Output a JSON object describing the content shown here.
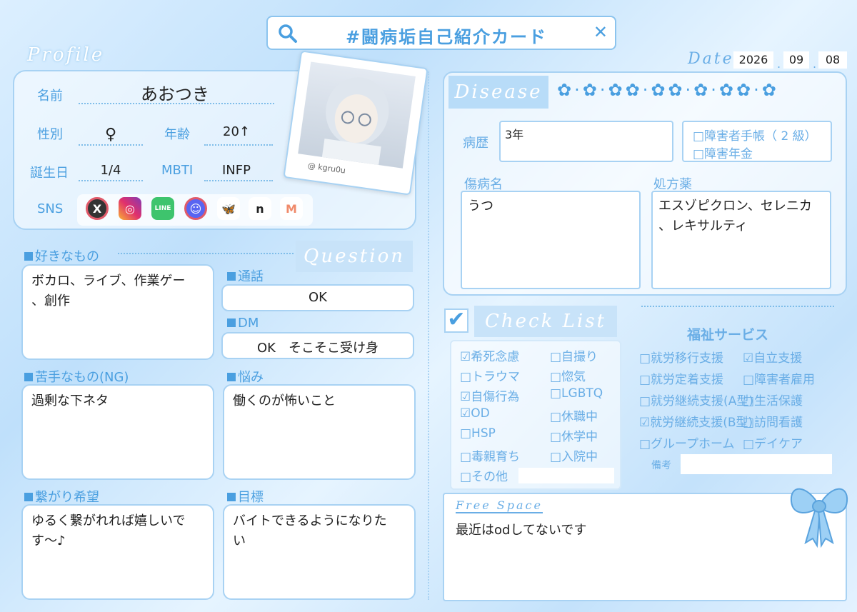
{
  "title": "#闘病垢自己紹介カード",
  "date": {
    "label": "Date",
    "year": "2026",
    "month": "09",
    "day": "08"
  },
  "profile": {
    "heading": "Profile",
    "name_label": "名前",
    "name": "あおつき",
    "gender_label": "性別",
    "gender": "♀",
    "age_label": "年齢",
    "age": "20↑",
    "birthday_label": "誕生日",
    "birthday": "1/4",
    "mbti_label": "MBTI",
    "mbti": "INFP",
    "sns_label": "SNS",
    "sns_icons": [
      "x-icon",
      "instagram-icon",
      "line-icon",
      "discord-icon",
      "bluesky-icon",
      "note-icon",
      "misskey-icon"
    ],
    "photo_handle": "@ kgru0u"
  },
  "likes": {
    "title": "好きなもの",
    "text": "ボカロ、ライブ、作業ゲー\n、創作"
  },
  "question": {
    "heading": "Question",
    "call_title": "通話",
    "call": "OK",
    "dm_title": "DM",
    "dm": "OK　そこそこ受け身"
  },
  "dislikes": {
    "title": "苦手なもの(NG)",
    "text": "過剰な下ネタ"
  },
  "worries": {
    "title": "悩み",
    "text": "働くのが怖いこと"
  },
  "connect": {
    "title": "繋がり希望",
    "text": "ゆるく繋がれれば嬉しいで\nす〜♪"
  },
  "goal": {
    "title": "目標",
    "text": "バイトできるようになりた\nい"
  },
  "disease": {
    "heading": "Disease",
    "history_label": "病歴",
    "history": "3年",
    "notebook": "□障害者手帳（ 2 級）",
    "pension": "□障害年金",
    "name_label": "傷病名",
    "name": "うつ",
    "meds_label": "処方薬",
    "meds": "エスゾピクロン、セレニカ\n、レキサルティ"
  },
  "checklist": {
    "heading": "Check List",
    "col1": [
      "☑希死念慮",
      "□トラウマ",
      "☑自傷行為",
      "☑OD",
      "□HSP",
      "□毒親育ち",
      "□その他"
    ],
    "col2": [
      "□自撮り",
      "□惚気",
      "□LGBTQ",
      "□休職中",
      "□休学中",
      "□入院中"
    ]
  },
  "welfare": {
    "title": "福祉サービス",
    "col1": [
      "□就労移行支援",
      "□就労定着支援",
      "□就労継続支援(A型)",
      "☑就労継続支援(B型)",
      "□グループホーム"
    ],
    "col2": [
      "☑自立支援",
      "□障害者雇用",
      "□生活保護",
      "□訪問看護",
      "□デイケア"
    ],
    "notes_label": "備考"
  },
  "free": {
    "heading": "Free Space",
    "text": "最近はodしてないです"
  },
  "colors": {
    "accent": "#4a9fe0",
    "border": "#a8d2f3",
    "banner": "#c8e3f9"
  }
}
